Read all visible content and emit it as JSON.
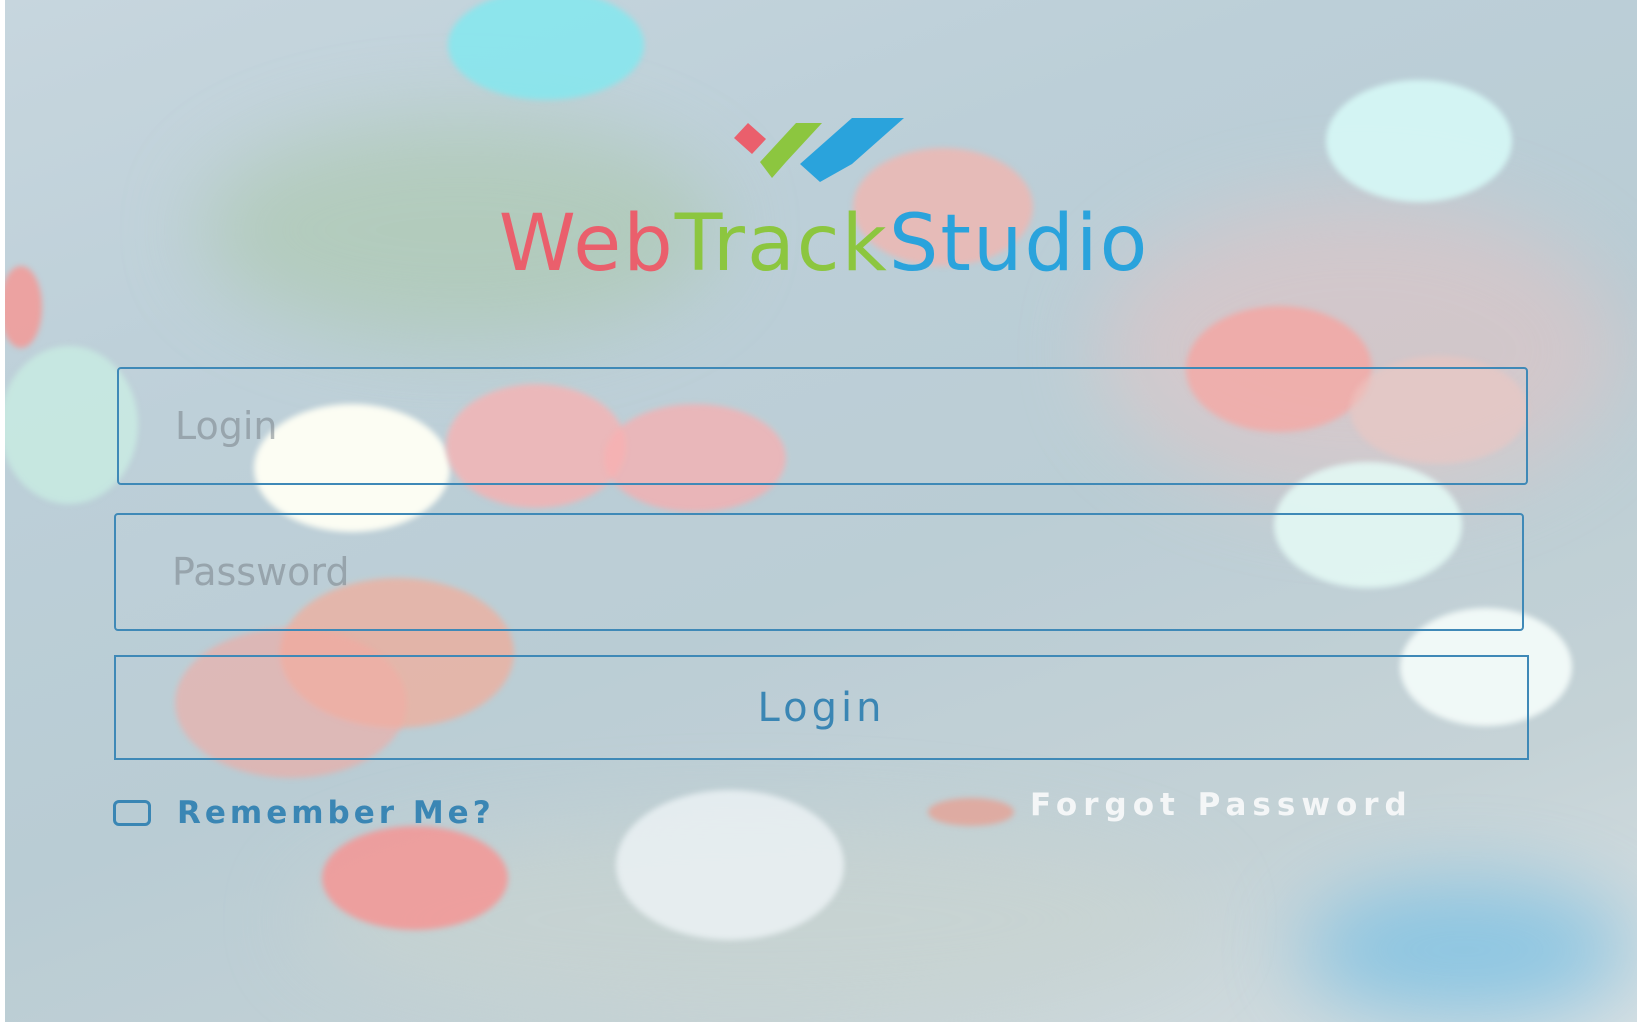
{
  "brand": {
    "part1": "Web",
    "part2": "Track",
    "part3": "Studio",
    "colors": {
      "red": "#ea5f6c",
      "green": "#8cc63f",
      "blue": "#2aa3dc"
    }
  },
  "form": {
    "login_placeholder": "Login",
    "password_placeholder": "Password",
    "login_value": "",
    "password_value": "",
    "submit_label": "Login",
    "remember_label": "Remember Me?",
    "remember_checked": false,
    "forgot_label": "Forgot Password"
  },
  "theme": {
    "accent": "#3a86b4",
    "background": "blurred bokeh pastel lights"
  }
}
